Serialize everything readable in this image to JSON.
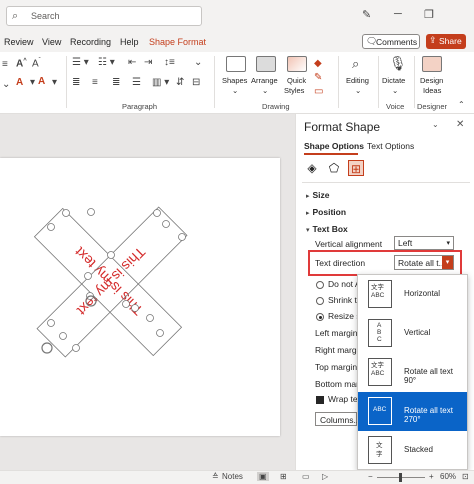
{
  "titlebar": {
    "search_placeholder": "Search",
    "minimize": "─",
    "restore": "❐",
    "pen_icon": "pen-icon"
  },
  "menu": {
    "tabs": [
      "Review",
      "View",
      "Recording",
      "Help",
      "Shape Format"
    ],
    "active_tab": "Shape Format",
    "comments_label": "Comments",
    "share_label": "Share"
  },
  "ribbon": {
    "groups": {
      "paragraph": "Paragraph",
      "drawing": "Drawing",
      "voice": "Voice",
      "designer": "Designer"
    },
    "buttons": {
      "shapes": "Shapes",
      "arrange": "Arrange",
      "quick_styles_1": "Quick",
      "quick_styles_2": "Styles",
      "editing": "Editing",
      "dictate": "Dictate",
      "design_ideas_1": "Design",
      "design_ideas_2": "Ideas"
    }
  },
  "slide": {
    "shape1_text": "This is my text",
    "shape2_text": "This is my text"
  },
  "pane": {
    "title": "Format Shape",
    "tab_shape": "Shape Options",
    "tab_text": "Text Options",
    "sections": {
      "size": "Size",
      "position": "Position",
      "text_box": "Text Box"
    },
    "vertical_alignment_label": "Vertical alignment",
    "vertical_alignment_value": "Left",
    "text_direction_label": "Text direction",
    "text_direction_value": "Rotate all t...",
    "options": {
      "do_not_autofit": "Do not A",
      "shrink_text": "Shrink te",
      "resize_shape": "Resize sh",
      "left_margin": "Left margin",
      "right_margin": "Right margin",
      "top_margin": "Top margin",
      "bottom_margin": "Bottom marg",
      "wrap_text": "Wrap tex",
      "columns": "Columns..."
    }
  },
  "text_direction_menu": {
    "items": [
      {
        "label": "Horizontal",
        "icon": "文字\nABC"
      },
      {
        "label": "Vertical",
        "icon": "A\nB\nC"
      },
      {
        "label": "Rotate all text 90°",
        "icon": "文字\nABC"
      },
      {
        "label": "Rotate all text 270°",
        "icon": "ABC"
      },
      {
        "label": "Stacked",
        "icon": "文\n字"
      }
    ],
    "selected_index": 3
  },
  "statusbar": {
    "notes": "Notes",
    "zoom": "60%",
    "minus": "−",
    "plus": "+"
  },
  "colors": {
    "accent": "#c43e1c",
    "selection": "#0a64c8",
    "highlight_box": "#e03a3a",
    "slide_text": "#d42a2a"
  }
}
